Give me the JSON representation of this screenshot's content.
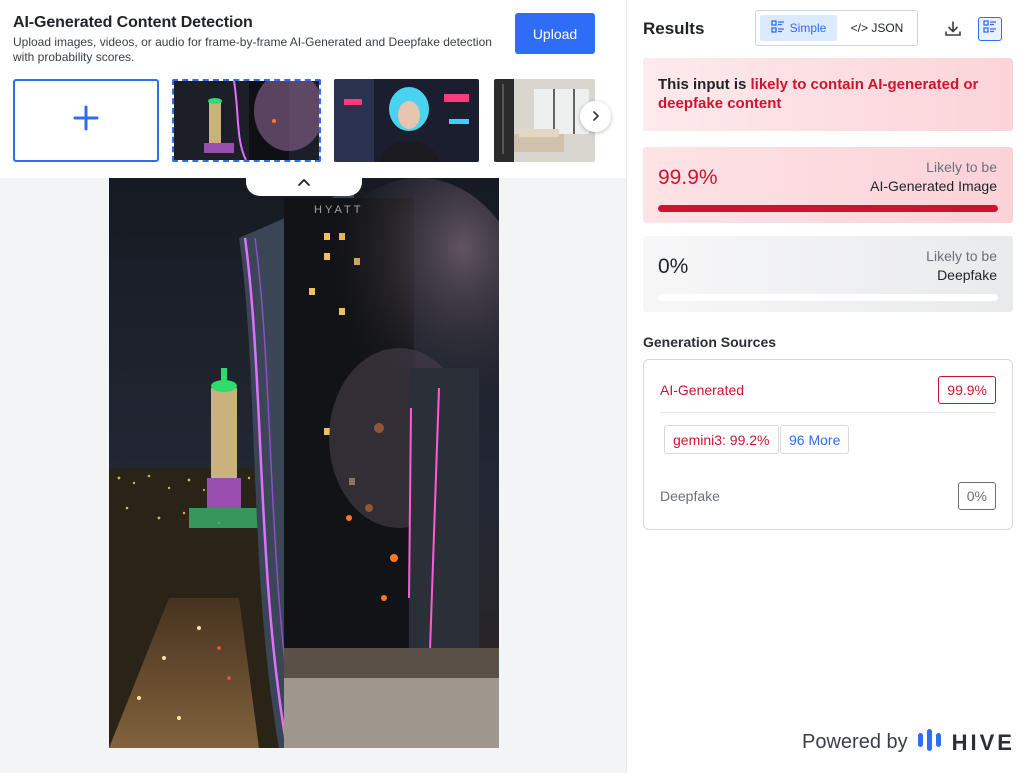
{
  "header": {
    "title": "AI-Generated Content Detection",
    "subtitle": "Upload images, videos, or audio for frame-by-frame AI-Generated and Deepfake detection with probability scores.",
    "upload_label": "Upload"
  },
  "icons": {
    "add": "plus-icon",
    "next": "chevron-right-icon",
    "collapse": "chevron-up-icon",
    "simple": "list-view-icon",
    "download": "download-icon",
    "view": "panel-view-icon",
    "hive": "hive-logo-icon"
  },
  "colors": {
    "accent": "#2f6df6",
    "danger": "#cc1431",
    "muted": "#6b7078"
  },
  "results": {
    "title": "Results",
    "toggle": {
      "simple_label": "Simple",
      "json_label": "</> JSON",
      "selected": "Simple"
    },
    "verdict": {
      "prefix": "This input is ",
      "highlight": "likely to contain AI-generated or deepfake content"
    },
    "scores": [
      {
        "value": "99.9%",
        "label_top": "Likely to be",
        "label_bottom": "AI-Generated Image",
        "fraction": 0.999
      },
      {
        "value": "0%",
        "label_top": "Likely to be",
        "label_bottom": "Deepfake",
        "fraction": 0.0
      }
    ],
    "generation": {
      "title": "Generation Sources",
      "ai_label": "AI-Generated",
      "ai_value": "99.9%",
      "source_chip": "gemini3: 99.2%",
      "more_chip": "96 More",
      "deepfake_label": "Deepfake",
      "deepfake_value": "0%"
    }
  },
  "footer": {
    "powered_by": "Powered by",
    "brand": "HIVE"
  }
}
